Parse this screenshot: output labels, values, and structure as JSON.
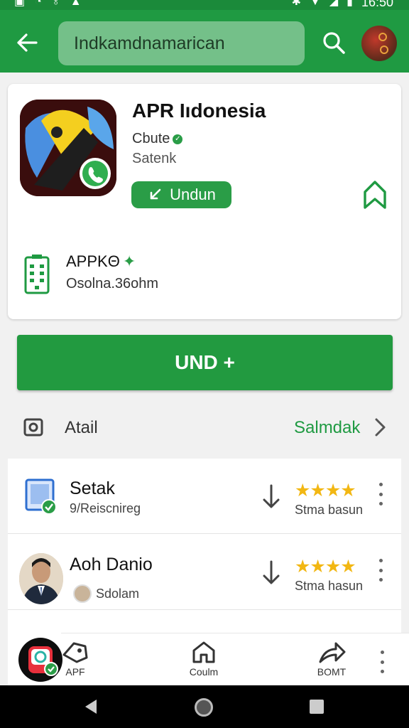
{
  "status_bar": {
    "time": "16:50"
  },
  "search": {
    "query": "Indkamdnamarican"
  },
  "app": {
    "title": "APR Iıdonesia",
    "developer": "Cbute",
    "category": "Satenk",
    "install_label": "Undun",
    "size_label": "APPKΘ",
    "size_value": "Osolna.36ohm"
  },
  "big_install": {
    "label": "UND +"
  },
  "section": {
    "title": "Atail",
    "link": "Salmdak"
  },
  "list": [
    {
      "title": "Setak",
      "subtitle": "9/Reiscnireg",
      "rating": "★★★★",
      "stat": "Stma basun"
    },
    {
      "title": "Aoh Danio",
      "subtitle": "Sdolam",
      "rating": "★★★★",
      "stat": "Stma hasun"
    }
  ],
  "bottom_nav": [
    {
      "label": "APF",
      "icon": "tag-icon"
    },
    {
      "label": "Coulm",
      "icon": "home-icon"
    },
    {
      "label": "BOMT",
      "icon": "share-icon"
    }
  ],
  "colors": {
    "primary": "#1f9a42",
    "accent_star": "#f2b713"
  }
}
